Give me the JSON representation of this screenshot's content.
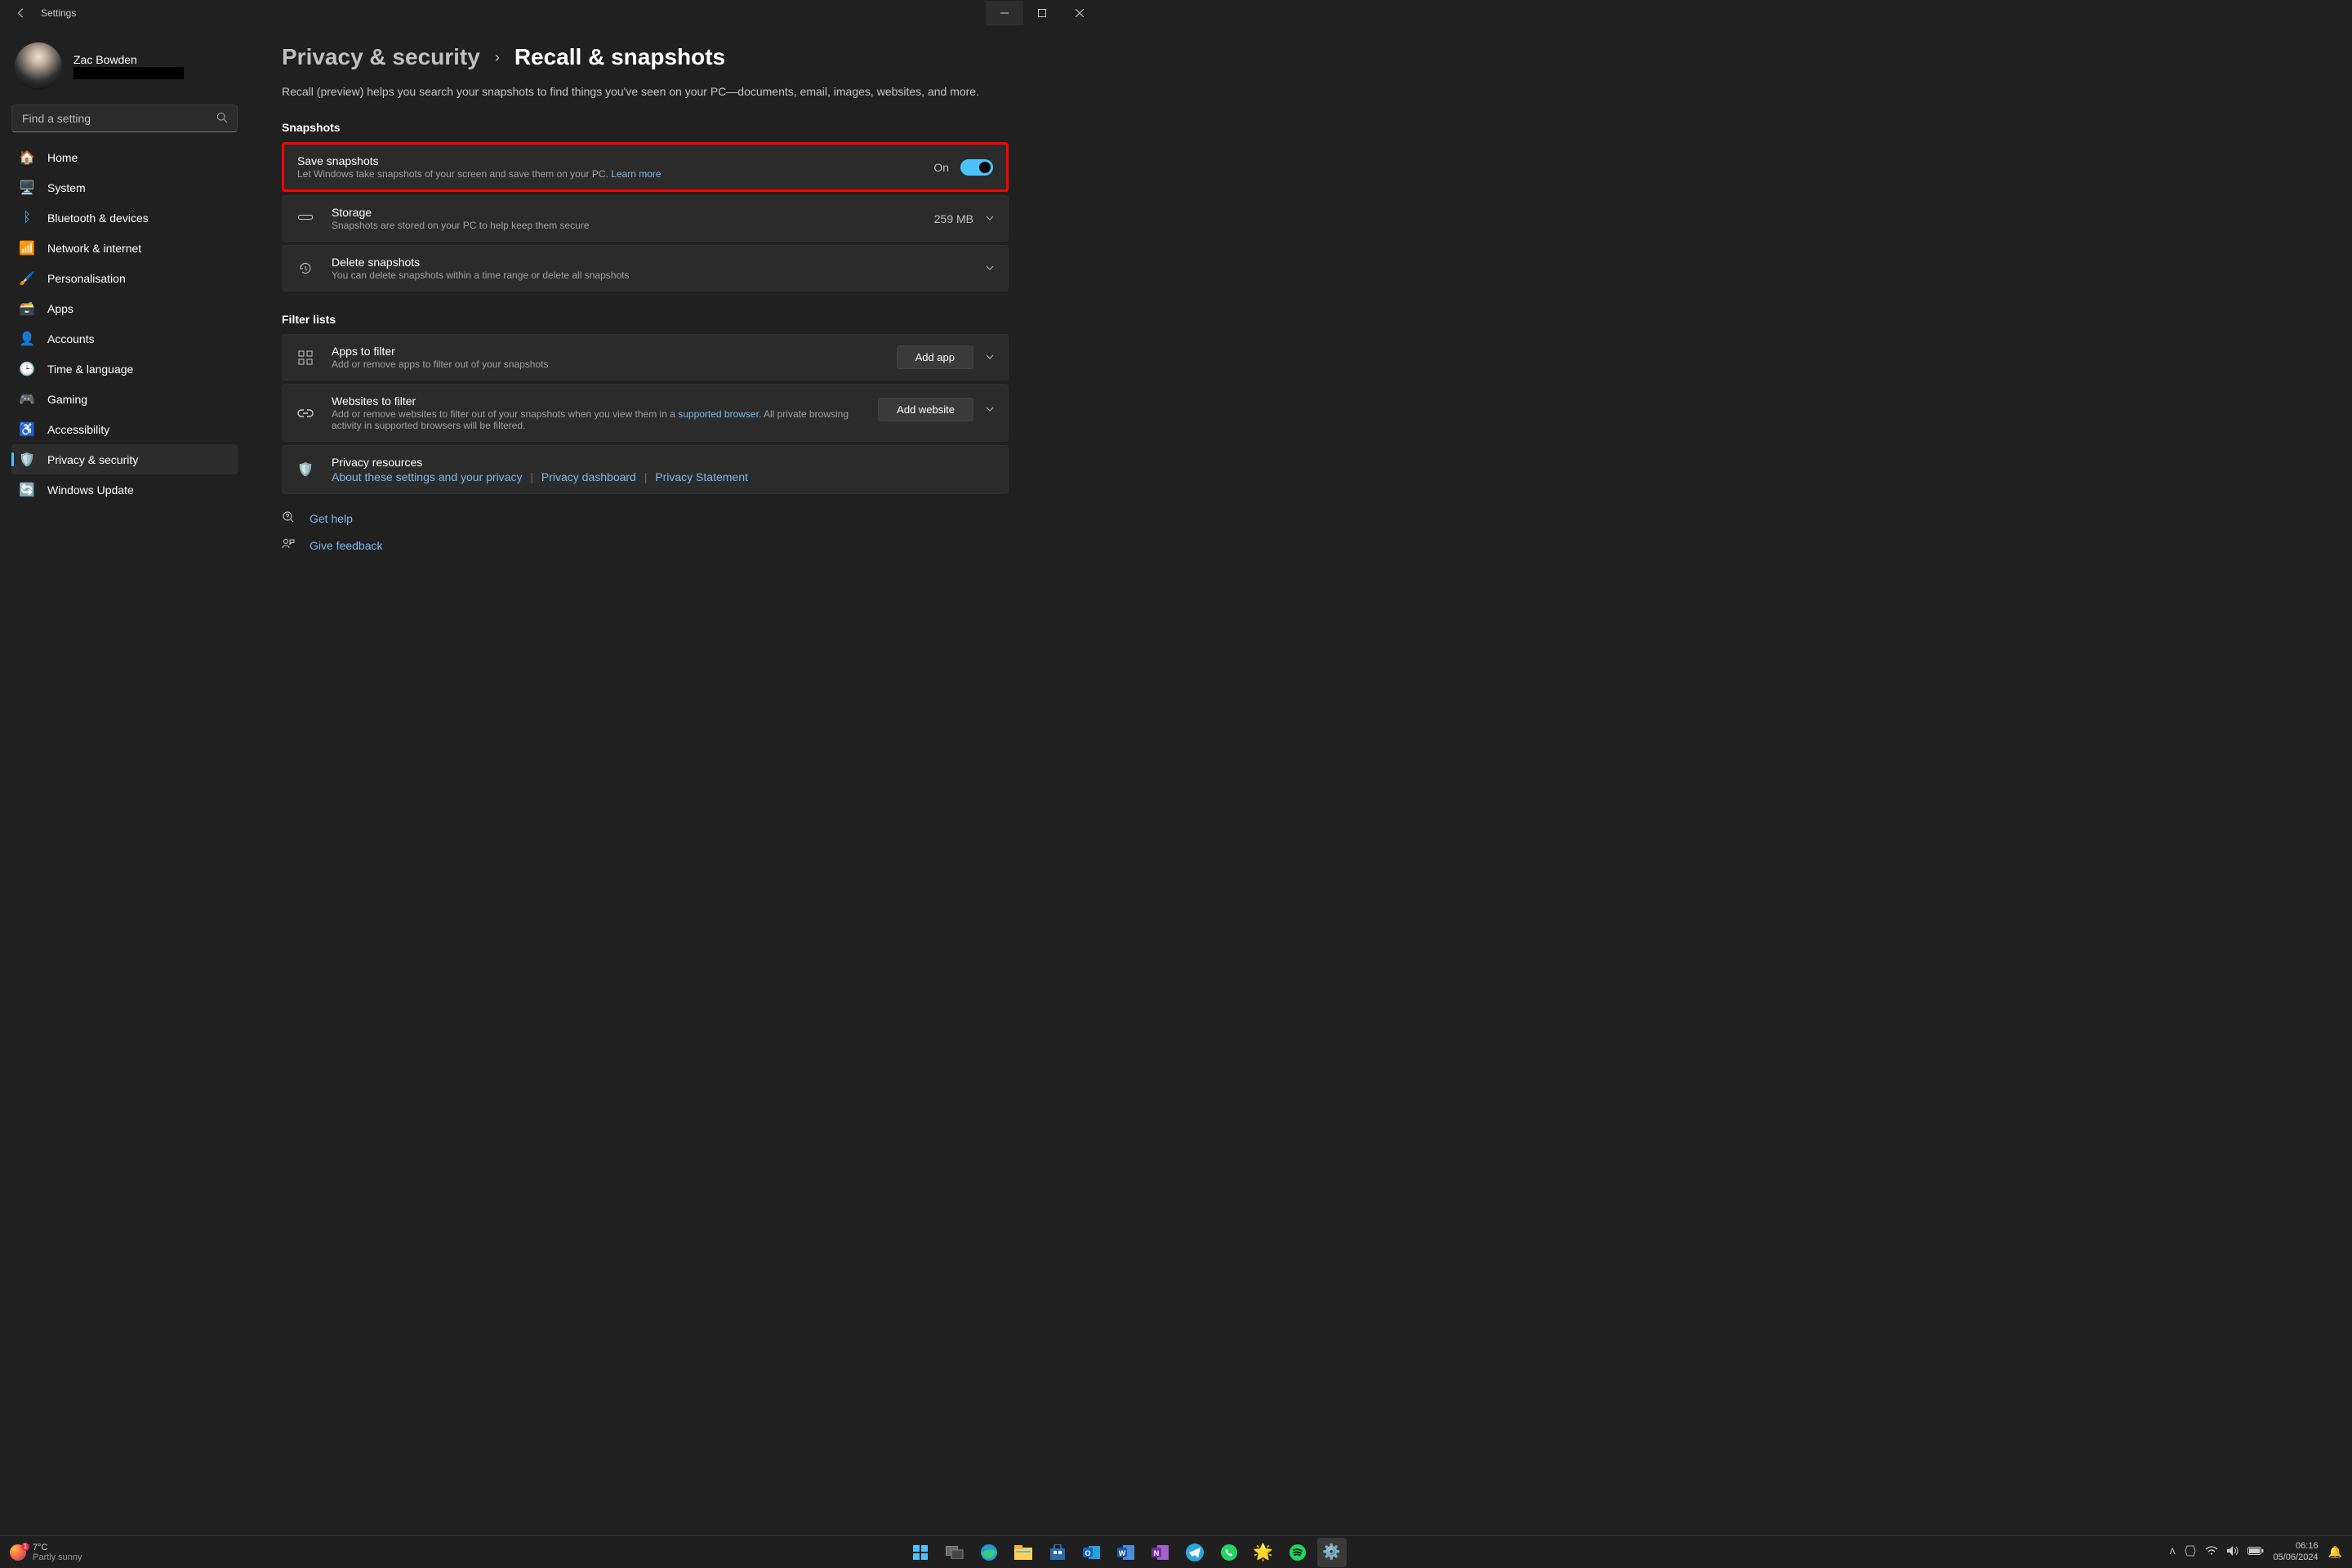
{
  "window": {
    "title": "Settings"
  },
  "user": {
    "name": "Zac Bowden"
  },
  "search": {
    "placeholder": "Find a setting"
  },
  "nav": {
    "items": [
      {
        "label": "Home"
      },
      {
        "label": "System"
      },
      {
        "label": "Bluetooth & devices"
      },
      {
        "label": "Network & internet"
      },
      {
        "label": "Personalisation"
      },
      {
        "label": "Apps"
      },
      {
        "label": "Accounts"
      },
      {
        "label": "Time & language"
      },
      {
        "label": "Gaming"
      },
      {
        "label": "Accessibility"
      },
      {
        "label": "Privacy & security"
      },
      {
        "label": "Windows Update"
      }
    ]
  },
  "breadcrumb": {
    "parent": "Privacy & security",
    "current": "Recall & snapshots"
  },
  "page": {
    "description": "Recall (preview) helps you search your snapshots to find things you've seen on your PC—documents, email, images, websites, and more.",
    "section1_title": "Snapshots",
    "save": {
      "title": "Save snapshots",
      "sub": "Let Windows take snapshots of your screen and save them on your PC. ",
      "learn": "Learn more",
      "state": "On"
    },
    "storage": {
      "title": "Storage",
      "sub": "Snapshots are stored on your PC to help keep them secure",
      "value": "259 MB"
    },
    "delete": {
      "title": "Delete snapshots",
      "sub": "You can delete snapshots within a time range or delete all snapshots"
    },
    "section2_title": "Filter lists",
    "apps_filter": {
      "title": "Apps to filter",
      "sub": "Add or remove apps to filter out of your snapshots",
      "button": "Add app"
    },
    "websites_filter": {
      "title": "Websites to filter",
      "sub_pre": "Add or remove websites to filter out of your snapshots when you view them in a ",
      "sub_link": "supported browser",
      "sub_post": ". All private browsing activity in supported browsers will be filtered.",
      "button": "Add website"
    },
    "privacy_resources": {
      "title": "Privacy resources",
      "link1": "About these settings and your privacy",
      "link2": "Privacy dashboard",
      "link3": "Privacy Statement"
    },
    "footer": {
      "help": "Get help",
      "feedback": "Give feedback"
    }
  },
  "taskbar": {
    "weather": {
      "temp": "7°C",
      "cond": "Partly sunny",
      "badge": "1"
    },
    "time": "06:16",
    "date": "05/06/2024"
  }
}
